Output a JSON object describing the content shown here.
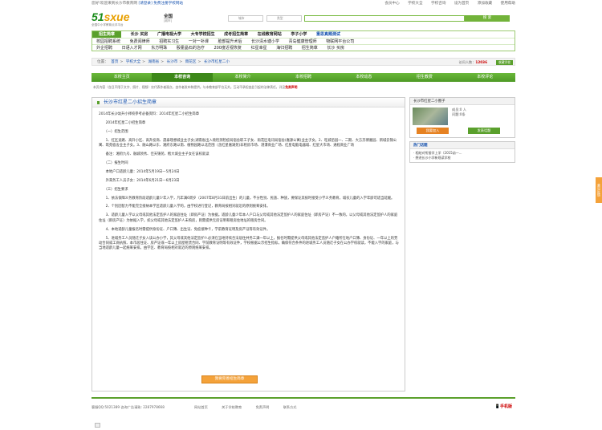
{
  "top": {
    "left_text": "您好!欢迎来到长沙市教育网",
    "login_link": "[请登录]",
    "register_link": "免费注册学校网站",
    "links": [
      "会员中心",
      "学校大全",
      "学校咨询",
      "设为首页",
      "添加收藏",
      "使用帮助"
    ]
  },
  "header": {
    "logo_text": "51sxue",
    "logo_sub": "全国中小学教育点评平台",
    "city": "全国",
    "city_sub": "[城市]",
    "select1": "城市",
    "select2": "类型",
    "search_placeholder": "",
    "search_button": "搜 索"
  },
  "nav": {
    "rows": [
      [
        "招生简章",
        "长沙 买房",
        "广播电视大学",
        "大专学校招生",
        "成考招生简章",
        "在线教育网站",
        "亭子小学",
        "重思真题测试"
      ],
      [
        "校园招聘系统",
        "免费阅律师",
        "招聘实习生",
        "一对一补课",
        "脸部提升术后",
        "长沙清水塘小学",
        "青岛健康管理师",
        "物联网平台公司"
      ],
      [
        "外企招聘",
        "日语入才网",
        "东方明珠",
        "殷霍晶石的治疗",
        "200度近视恢复",
        "红星幸星",
        "海归招聘",
        "招生简章",
        "长沙 买房"
      ]
    ]
  },
  "breadcrumb": {
    "label": "位置：",
    "items": [
      "首页",
      "学校大全",
      "湖南省",
      "长沙市",
      "雨花区",
      "长沙市红星二小"
    ],
    "visits_label": "访问人数：",
    "visits_value": "12036",
    "fav": "收藏学校"
  },
  "tabs": [
    "本校主页",
    "本校咨询",
    "本校简介",
    "本校招聘",
    "本校动态",
    "招生教费",
    "本校评论"
  ],
  "notice": "本页内容（含且不限于文字、照片、视频）仅代表作者观点，由作者发布和提供。与本教育部平台无关。互动不承担由此引起的法律责任，详见",
  "notice_link": "免责声明",
  "main": {
    "title": "长沙市红星二小招生简章",
    "paras": [
      "2014年长沙幼升小择校参考必备资料：2014年红星二小招生简章",
      "　　2014年红星二小招生简章",
      "　　（一）招生范围",
      "　　1、红区迪路、高升小区、高升投商、晟泰理想城业主子女;湖南省出入境检测检疫局宿舍职工子女、雨花区电讯局宿舍(嘉源公寓)业主子女。2、旺城佰园一、二期、大方苏博嘉园、新城云锦公寓、筑苑宿舍业主子女。3、融山路以东、湘府东路以南、植物园路以北范围（含红星嘉湖苑)非租房市场、港瀑商业广场、红星电脑电器城、红星大市场、通程商业广场",
      "　　备注：湘府九号、融城领秀、佳天锦苑、楷大城业主子女在该校就读",
      "　　（二）报生时间",
      "　　本地户口适龄儿童：2014年5月19日—5月24日",
      "　　外来务工人员子女：2014年6月21日—6月23日",
      "　　（三）招生要求",
      "　　1、依法保障义务教育阶段适龄儿童少年入学，凡年满6周岁（2007年8月31日前出生）的儿童，不分性别、民族、种族，要保证其按时接受小学义务教育，城农儿童的入学年龄可适当延缓。",
      "　　2、个别因智力不能完全接纳本学区适龄儿童入学的，由学校进行登记，教育局按相对就近的原则统筹安排。",
      "　　3、适龄儿童入学以父母或其他法定监护人的家庭住址（即房产证）为依据。适龄儿童少年本人户口与父母或其他法定监护人的家庭住址（即房产证）不一致的，以父母或其他法定监护人的家庭住址（即房产证）为依据入学。如父母或其他法定监护人未购房，则需提供无房证明和租房住地址的租房合同。",
      "　　4、本地适龄儿童报名时需提供身份证、户口簿、出生证、免疫接种卡，学前教育证明及房产证等有效证件。",
      "　　5、进城务工人员随迁子女入读公办小学，其父母或其他法定监护人必须在当地持续合法居住并务工满一年以上，报名时需提供父母或其他法定监护人户籍所在地户口簿、身份证、一年以上的劳动合同或工商执照、本市居住证、房产证或一年以上房屋租赁合同、学前教育证明等有效证件，学校根据公示招生指标，确保符合条件的进城务工人员随迁子女在公办学校就读，不能入学的家庭，与当地适龄儿童一起统筹安排。由学区、教育局按相对就近的原则统筹安排。"
    ],
    "button": "我要完善招生简章"
  },
  "side": {
    "school_box_title": "长沙市红星二小圈子",
    "members": "成员:0 人",
    "topics": "问题:0条",
    "btn_join": "我要加入",
    "btn_ask": "发表话题",
    "news_title": "热门话题",
    "news": [
      "相结对衔接学上学（2015幼一...",
      "想进长沙小学新规读学校"
    ]
  },
  "footer": {
    "phone": "客服QQ:5021389 咨询广告请致: 2287978668",
    "links": [
      "网站首页",
      "关于学校教育",
      "免责声明",
      "联系方式"
    ],
    "mobile": "手机版"
  },
  "floater": "意见反馈"
}
